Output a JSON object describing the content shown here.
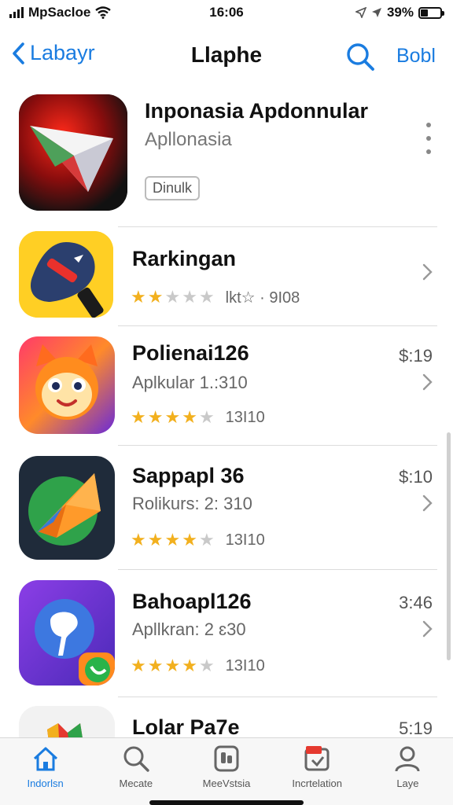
{
  "status": {
    "carrier": "MpSacloe",
    "time": "16:06",
    "battery": "39%",
    "battery_level": 0.39
  },
  "nav": {
    "back_label": "Labayr",
    "title": "Llaphe",
    "right_label": "Bobl",
    "icons": {
      "back": "chevron-left-icon",
      "search": "search-icon"
    }
  },
  "featured": {
    "title": "Inponasia Apdonnular",
    "subtitle": "Apllonasia",
    "badge": "Dinulk"
  },
  "apps": [
    {
      "title": "Rarkingan",
      "subtitle": "",
      "price": "",
      "stars": 1.5,
      "rating_text": "lkt☆ · 9I08",
      "icon": "map-pin-icon"
    },
    {
      "title": "Polienai126",
      "subtitle": "Aplkular 1.:310",
      "price": "$:19",
      "stars": 4,
      "rating_text": "13I10",
      "icon": "cat-face-icon"
    },
    {
      "title": "Sappapl 36",
      "subtitle": "Rolikurs: 2: 310",
      "price": "$:10",
      "stars": 4,
      "rating_text": "13I10",
      "icon": "kite-icon"
    },
    {
      "title": "Bahoapl126",
      "subtitle": "Apllkran: 2 ɛ30",
      "price": "3:46",
      "stars": 3.5,
      "rating_text": "13I10",
      "icon": "chat-bubble-icon"
    },
    {
      "title": "Lolar Pa7e",
      "subtitle": "",
      "price": "5:19",
      "stars": 0,
      "rating_text": "",
      "icon": "flag-icon"
    }
  ],
  "tabs": [
    {
      "label": "Indorlsn",
      "icon": "home-icon",
      "active": true
    },
    {
      "label": "Mecate",
      "icon": "search-icon",
      "active": false
    },
    {
      "label": "MeeVstsia",
      "icon": "apps-icon",
      "active": false
    },
    {
      "label": "Incrtelation",
      "icon": "updates-icon",
      "active": false
    },
    {
      "label": "Laye",
      "icon": "profile-icon",
      "active": false
    }
  ],
  "colors": {
    "accent": "#1a7ce0",
    "star": "#f2b01e"
  }
}
